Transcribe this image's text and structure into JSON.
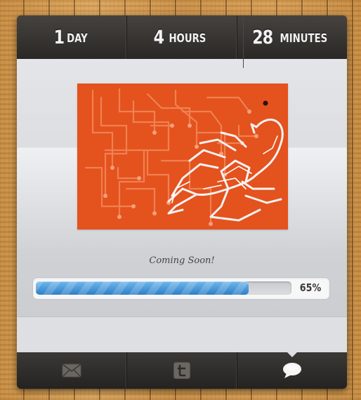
{
  "countdown": {
    "days": {
      "value": "1",
      "unit": "DAY"
    },
    "hours": {
      "value": "4",
      "unit": "HOURS"
    },
    "minutes": {
      "value": "28",
      "unit": "MINUTES"
    }
  },
  "main": {
    "tagline": "Coming Soon!",
    "progress": {
      "percent": 65,
      "label": "65%"
    },
    "artwork": {
      "subject": "scorpion on circuit board",
      "background_color": "#e4521d"
    }
  },
  "social": {
    "items": [
      {
        "icon": "mail-icon",
        "active": false
      },
      {
        "icon": "twitter-icon",
        "active": false
      },
      {
        "icon": "chat-bubble-icon",
        "active": true
      }
    ]
  },
  "colors": {
    "progress_fill": "#2e7fc7",
    "bar_dark": "#2e2c2a",
    "wood": "#c9934a"
  }
}
